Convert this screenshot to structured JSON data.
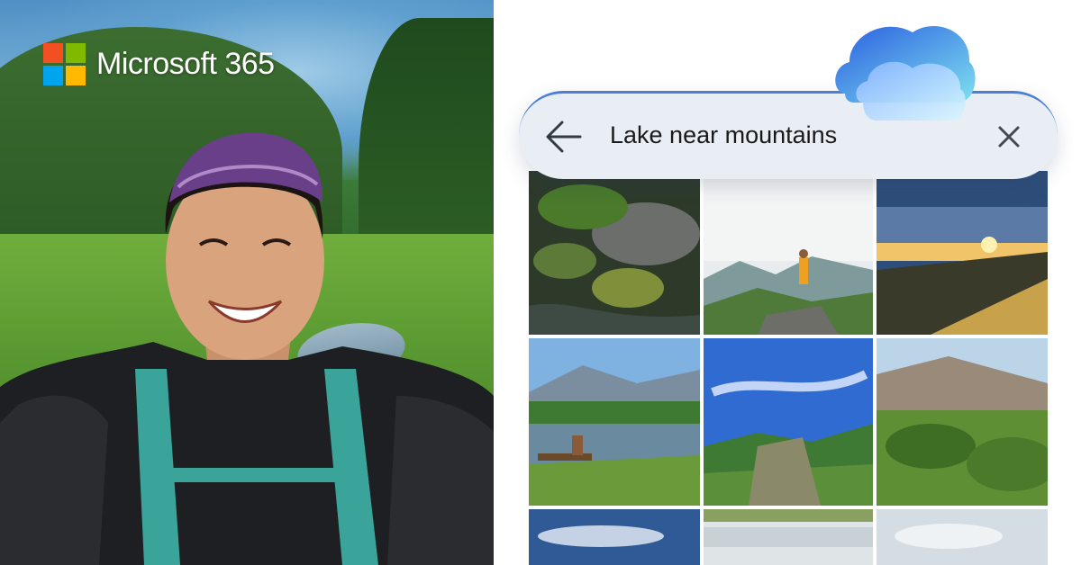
{
  "brand": {
    "logo_text": "Microsoft 365",
    "colors": {
      "red": "#f25022",
      "green": "#7fba00",
      "blue": "#00a4ef",
      "yellow": "#ffb900"
    }
  },
  "search": {
    "query": "Lake near mountains",
    "back_icon": "back-arrow-icon",
    "clear_icon": "close-icon",
    "accent": "#4a7fd6"
  },
  "decor": {
    "cloud_icon": "onedrive-cloud-icon"
  },
  "results": {
    "photos": [
      {
        "name": "mossy-stream-photo"
      },
      {
        "name": "hiker-summit-photo"
      },
      {
        "name": "coastal-sunset-photo"
      },
      {
        "name": "lake-bench-reader-photo"
      },
      {
        "name": "blue-sky-valley-photo"
      },
      {
        "name": "green-hills-photo"
      },
      {
        "name": "cloudy-sky-photo"
      },
      {
        "name": "bright-water-photo"
      },
      {
        "name": "pale-sky-photo"
      }
    ]
  }
}
